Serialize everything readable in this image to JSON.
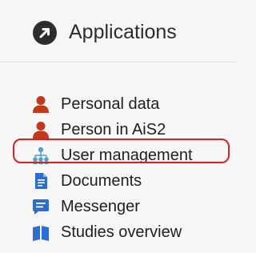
{
  "header": {
    "title": "Applications",
    "icon": "arrow-circle-icon"
  },
  "menu": {
    "items": [
      {
        "label": "Personal data",
        "icon": "person-icon",
        "color": "#c0391b"
      },
      {
        "label": "Person in AiS2",
        "icon": "person-icon",
        "color": "#c0391b"
      },
      {
        "label": "User management",
        "icon": "org-chart-icon",
        "color": "#4aa3c9",
        "highlighted": true
      },
      {
        "label": "Documents",
        "icon": "documents-icon",
        "color": "#2c6dd5"
      },
      {
        "label": "Messenger",
        "icon": "chat-icon",
        "color": "#2c6dd5"
      },
      {
        "label": "Studies overview",
        "icon": "studies-icon",
        "color": "#2c6dd5"
      }
    ]
  },
  "colors": {
    "highlight_border": "#e02020",
    "header_icon": "#2d2d2d"
  }
}
